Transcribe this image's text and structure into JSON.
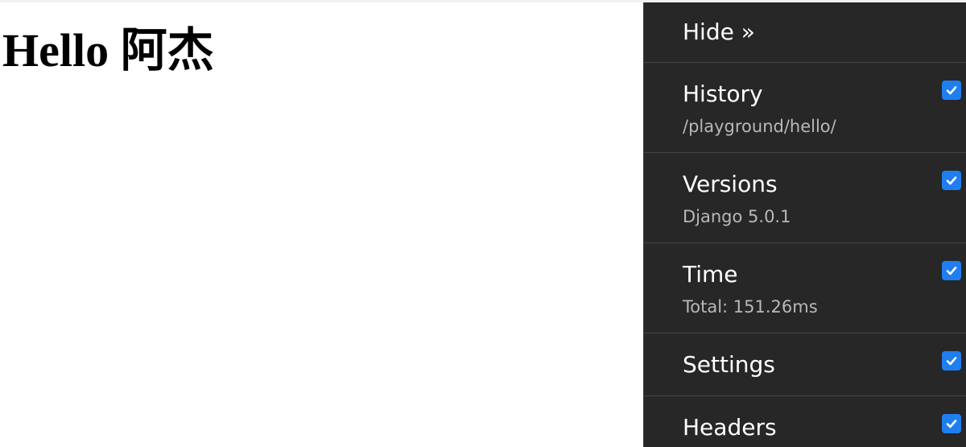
{
  "page": {
    "heading": "Hello 阿杰"
  },
  "toolbar": {
    "hide_label": "Hide »",
    "panels": [
      {
        "title": "History",
        "subtitle": "/playground/hello/",
        "checked": true
      },
      {
        "title": "Versions",
        "subtitle": "Django 5.0.1",
        "checked": true
      },
      {
        "title": "Time",
        "subtitle": "Total: 151.26ms",
        "checked": true
      },
      {
        "title": "Settings",
        "subtitle": "",
        "checked": true
      },
      {
        "title": "Headers",
        "subtitle": "",
        "checked": true
      }
    ]
  },
  "colors": {
    "toolbar_bg": "#272727",
    "checkbox_accent": "#1f7ef0",
    "subtitle_text": "#b8b8b8"
  },
  "icons": {
    "checkbox": "checkmark-icon"
  }
}
